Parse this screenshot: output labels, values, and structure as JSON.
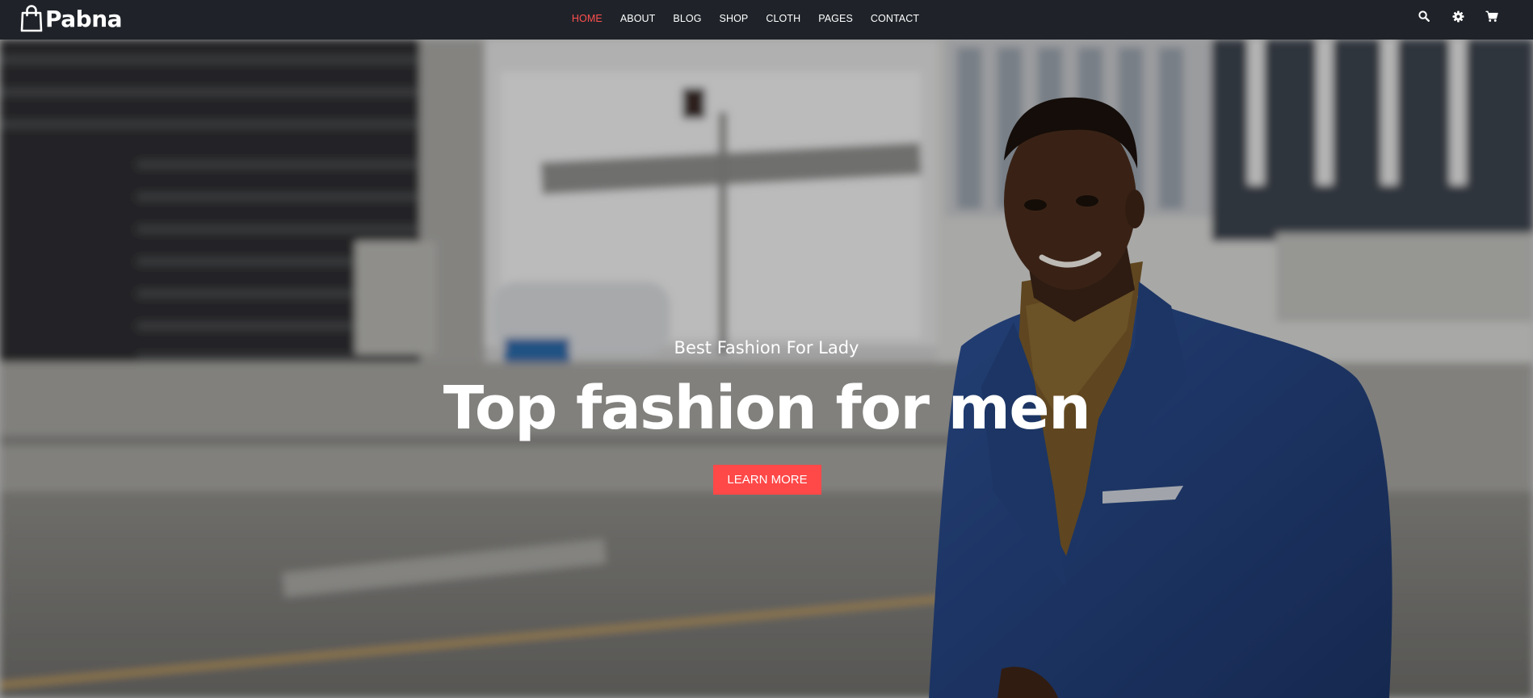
{
  "brand": {
    "name": "Pabna",
    "icon": "shopping-bag-icon"
  },
  "nav": {
    "items": [
      {
        "label": "HOME",
        "active": true
      },
      {
        "label": "ABOUT",
        "active": false
      },
      {
        "label": "BLOG",
        "active": false
      },
      {
        "label": "SHOP",
        "active": false
      },
      {
        "label": "CLOTH",
        "active": false
      },
      {
        "label": "PAGES",
        "active": false
      },
      {
        "label": "CONTACT",
        "active": false
      }
    ],
    "active_color": "#ff4f4f"
  },
  "toolbar": {
    "icons": [
      "search-icon",
      "gear-icon",
      "cart-icon"
    ]
  },
  "hero": {
    "subtitle": "Best Fashion For Lady",
    "headline": "Top fashion for men",
    "cta_label": "LEARN MORE",
    "cta_color": "#ff4848"
  }
}
